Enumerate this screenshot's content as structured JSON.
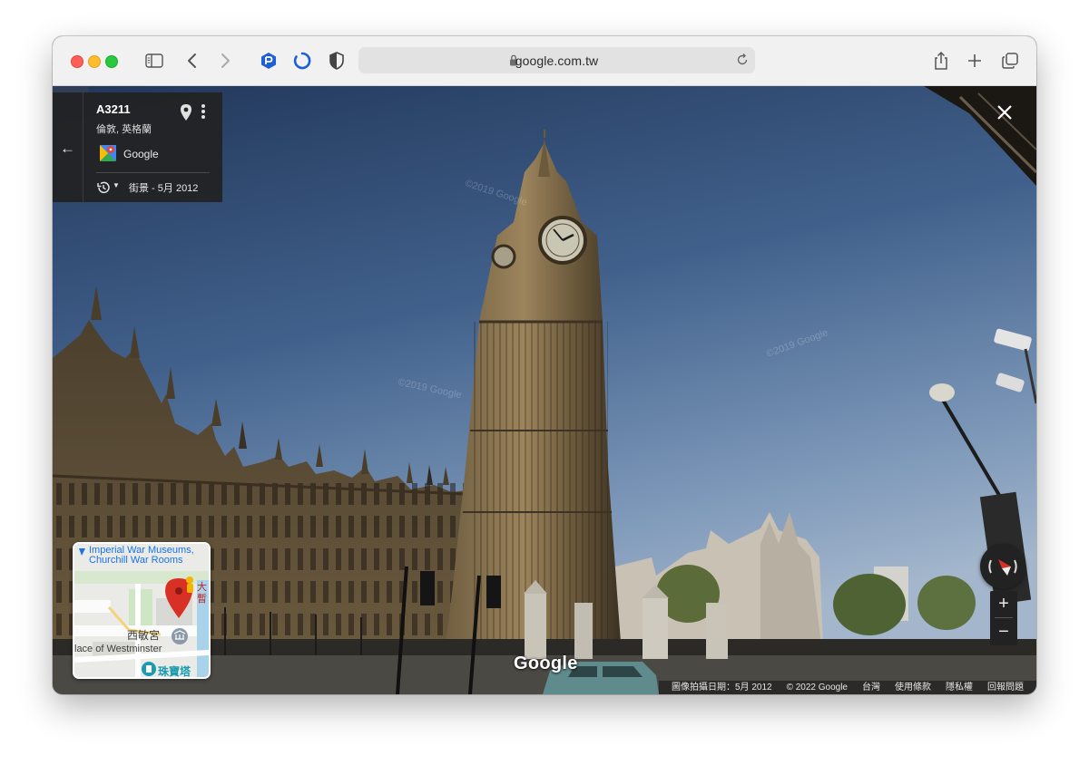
{
  "browser": {
    "url": "google.com.tw",
    "icons": [
      "sidebar-icon",
      "back-icon",
      "forward-icon",
      "extension-hex-icon",
      "loading-ring-icon",
      "privacy-shield-icon",
      "lock-icon",
      "reload-icon",
      "share-icon",
      "new-tab-icon",
      "tab-overview-icon"
    ]
  },
  "info_panel": {
    "title": "A3211",
    "subtitle": "倫敦, 英格蘭",
    "source_label": "Google",
    "history_label": "街景 - 5月 2012"
  },
  "minimap": {
    "labels": {
      "museum_line1": "Imperial War Museums,",
      "museum_line2": "Churchill War Rooms",
      "palace_zh": "西敏宮",
      "palace_en": "lace of Westminster",
      "tower": "珠寶塔",
      "partial_red_1": "大",
      "partial_red_2": "暫"
    }
  },
  "controls": {
    "zoom_in": "+",
    "zoom_out": "−",
    "close": "×"
  },
  "logo": "Google",
  "watermarks": [
    "©2019 Google",
    "©2019 Google",
    "©2019 Google"
  ],
  "footer": {
    "capture_date": "圖像拍攝日期：5月 2012",
    "copyright": "© 2022 Google",
    "region": "台灣",
    "terms": "使用條款",
    "privacy": "隱私權",
    "report": "回報問題"
  },
  "colors": {
    "sky_top": "#2b4266",
    "sky_bottom": "#93a9c4",
    "stone": "#8a7654",
    "panel_bg": "#222222",
    "accent_blue": "#1a73e8"
  }
}
